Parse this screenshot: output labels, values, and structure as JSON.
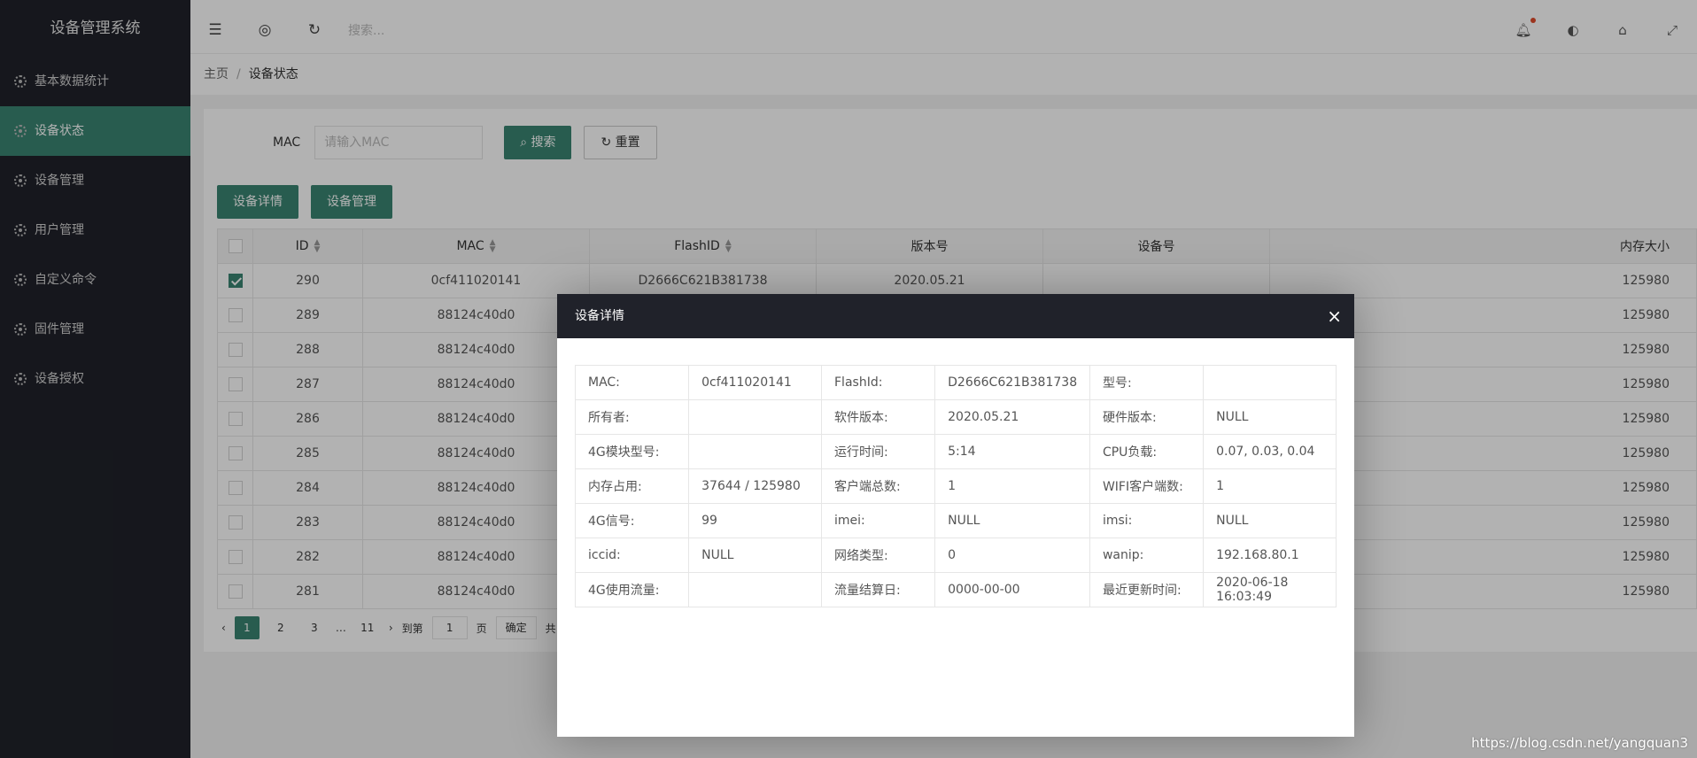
{
  "app": {
    "title": "设备管理系统"
  },
  "sidebar": {
    "items": [
      {
        "label": "基本数据统计",
        "active": false
      },
      {
        "label": "设备状态",
        "active": true
      },
      {
        "label": "设备管理",
        "active": false
      },
      {
        "label": "用户管理",
        "active": false
      },
      {
        "label": "自定义命令",
        "active": false
      },
      {
        "label": "固件管理",
        "active": false
      },
      {
        "label": "设备授权",
        "active": false
      }
    ]
  },
  "header": {
    "search_placeholder": "搜索..."
  },
  "breadcrumb": {
    "home": "主页",
    "sep": "/",
    "current": "设备状态"
  },
  "filter": {
    "mac_label": "MAC",
    "mac_placeholder": "请输入MAC",
    "search_label": "搜索",
    "reset_label": "重置"
  },
  "toolbar": {
    "detail_label": "设备详情",
    "manage_label": "设备管理"
  },
  "table": {
    "columns": [
      "ID",
      "MAC",
      "FlashID",
      "版本号",
      "设备号",
      "内存大小"
    ],
    "rows": [
      {
        "checked": true,
        "id": "290",
        "mac": "0cf411020141",
        "flash": "D2666C621B381738",
        "ver": "2020.05.21",
        "dev": "",
        "mem": "125980"
      },
      {
        "checked": false,
        "id": "289",
        "mac": "88124c40d0",
        "flash": "",
        "ver": "",
        "dev": "",
        "mem": "125980"
      },
      {
        "checked": false,
        "id": "288",
        "mac": "88124c40d0",
        "flash": "",
        "ver": "",
        "dev": "",
        "mem": "125980"
      },
      {
        "checked": false,
        "id": "287",
        "mac": "88124c40d0",
        "flash": "",
        "ver": "",
        "dev": "",
        "mem": "125980"
      },
      {
        "checked": false,
        "id": "286",
        "mac": "88124c40d0",
        "flash": "",
        "ver": "",
        "dev": "",
        "mem": "125980"
      },
      {
        "checked": false,
        "id": "285",
        "mac": "88124c40d0",
        "flash": "",
        "ver": "",
        "dev": "",
        "mem": "125980"
      },
      {
        "checked": false,
        "id": "284",
        "mac": "88124c40d0",
        "flash": "",
        "ver": "",
        "dev": "",
        "mem": "125980"
      },
      {
        "checked": false,
        "id": "283",
        "mac": "88124c40d0",
        "flash": "",
        "ver": "",
        "dev": "",
        "mem": "125980"
      },
      {
        "checked": false,
        "id": "282",
        "mac": "88124c40d0",
        "flash": "",
        "ver": "",
        "dev": "",
        "mem": "125980"
      },
      {
        "checked": false,
        "id": "281",
        "mac": "88124c40d0",
        "flash": "",
        "ver": "",
        "dev": "",
        "mem": "125980"
      }
    ]
  },
  "pager": {
    "pages": [
      "1",
      "2",
      "3"
    ],
    "ellipsis": "…",
    "last": "11",
    "goto_label": "到第",
    "goto_value": "1",
    "page_unit": "页",
    "confirm": "确定",
    "total_prefix": "共"
  },
  "modal": {
    "title": "设备详情",
    "close": "×",
    "rows": [
      [
        "MAC:",
        "0cf411020141",
        "FlashId:",
        "D2666C621B381738",
        "型号:",
        ""
      ],
      [
        "所有者:",
        "",
        "软件版本:",
        "2020.05.21",
        "硬件版本:",
        "NULL"
      ],
      [
        "4G模块型号:",
        "",
        "运行时间:",
        "5:14",
        "CPU负载:",
        "0.07, 0.03, 0.04"
      ],
      [
        "内存占用:",
        "37644 / 125980",
        "客户端总数:",
        "1",
        "WIFI客户端数:",
        "1"
      ],
      [
        "4G信号:",
        "99",
        "imei:",
        "NULL",
        "imsi:",
        "NULL"
      ],
      [
        "iccid:",
        "NULL",
        "网络类型:",
        "0",
        "wanip:",
        "192.168.80.1"
      ],
      [
        "4G使用流量:",
        "",
        "流量结算日:",
        "0000-00-00",
        "最近更新时间:",
        "2020-06-18 16:03:49"
      ]
    ]
  },
  "watermark": "https://blog.csdn.net/yangquan3",
  "colors": {
    "accent": "#3a8572",
    "sidebar_bg": "#20222a",
    "notify_dot": "#e04b2b"
  }
}
